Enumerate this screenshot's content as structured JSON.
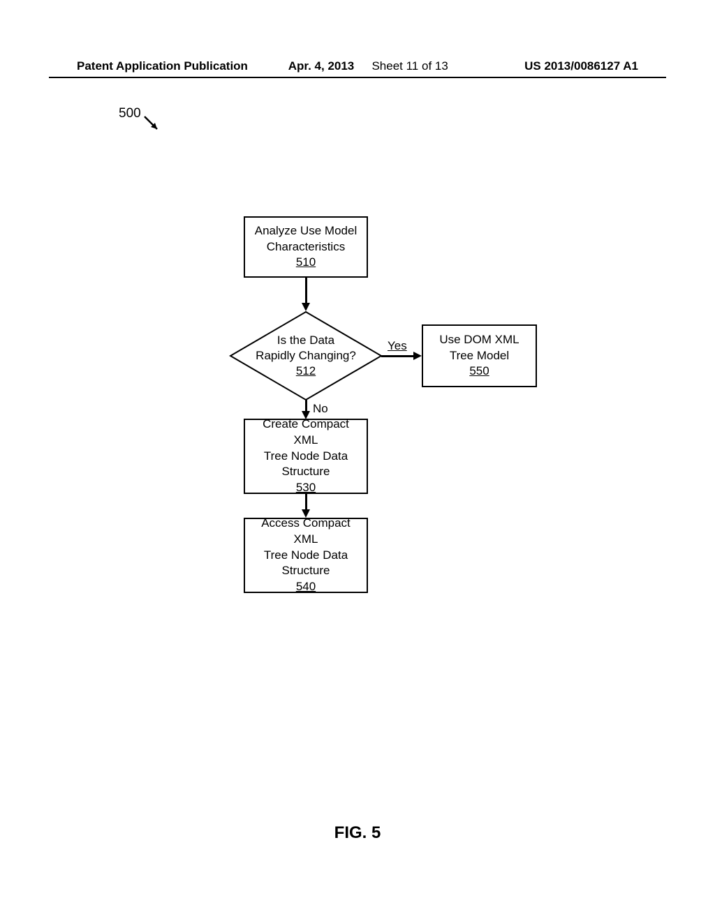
{
  "header": {
    "left": "Patent Application Publication",
    "date": "Apr. 4, 2013",
    "sheet": "Sheet 11 of 13",
    "pubnum": "US 2013/0086127 A1"
  },
  "reference": {
    "number": "500"
  },
  "boxes": {
    "b510": {
      "line1": "Analyze Use Model",
      "line2": "Characteristics",
      "ref": "510"
    },
    "b512": {
      "line1": "Is the Data",
      "line2": "Rapidly Changing?",
      "ref": "512"
    },
    "b530": {
      "line1": "Create Compact XML",
      "line2": "Tree Node Data",
      "line3": "Structure",
      "ref": "530"
    },
    "b540": {
      "line1": "Access Compact XML",
      "line2": "Tree Node Data",
      "line3": "Structure",
      "ref": "540"
    },
    "b550": {
      "line1": "Use DOM XML",
      "line2": "Tree Model",
      "ref": "550"
    }
  },
  "labels": {
    "yes": "Yes",
    "no": "No"
  },
  "figure": {
    "caption": "FIG. 5"
  }
}
